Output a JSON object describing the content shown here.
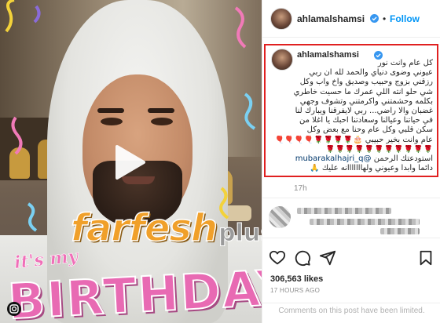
{
  "media": {
    "watermark_main": "farfesh",
    "watermark_sub": "plus.com",
    "overlay_small": "it's my",
    "overlay_big": "BIRTHDAY",
    "icons": {
      "play": "play-icon",
      "instagram": "instagram-glyph-icon"
    }
  },
  "post": {
    "username": "ahlamalshamsi",
    "verified_icon": "verified-badge-icon",
    "follow_separator": "•",
    "follow_label": "Follow",
    "caption": {
      "username": "ahlamalshamsi",
      "lines": [
        "كل عام وانت نور",
        "عيوني وضوى دنياي والحمد لله ان ربي",
        "رزقني بزوج وحبيب وصديق واخ واب وكل",
        "شي حلو انته اللي عمرك ما حسيت خاطري",
        "بكلمه وحشمتني وأكرمتني وتشوف وجهي",
        "غضبان والا راضي... ربي لايفرقنا ويبارك لنا",
        "في حياتنا وعيالنا وسعادتنا احبك يا اغلا من",
        "سكن قلبي وكل عام وحنا مع بعض وكل",
        "عام وانت بخير حبيبي 🎂🌹🌹🌹🌹🎈🎈🎈🎈"
      ],
      "emoji_line": "🌹🌹🌹🌹🌹🌹🌹🌹🌹🌹🌹",
      "mention": "@mubarakalhajri_q",
      "mention_prefix": "استودعتك الرحمن",
      "last_line": "دائماً وأبداً وعيوني ولهااااااانه عليك 🙏",
      "time": "17h"
    },
    "likes": "306,563 likes",
    "posted_ago": "17 HOURS AGO",
    "comments_limited": "Comments on this post have been limited.",
    "action_icons": [
      "heart-icon",
      "comment-icon",
      "share-icon",
      "bookmark-icon"
    ]
  },
  "colors": {
    "accent": "#0095f6",
    "highlight_border": "#e02020",
    "mention": "#00376b"
  }
}
